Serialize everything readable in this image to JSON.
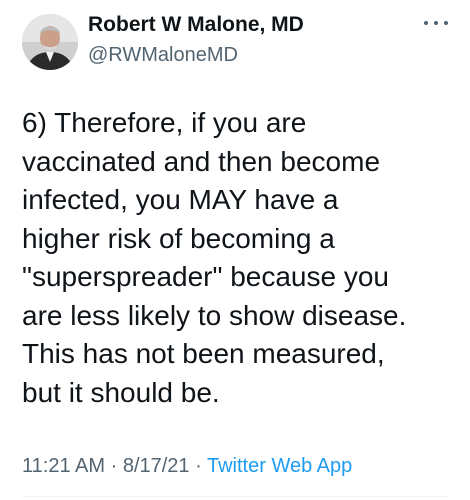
{
  "author": {
    "display_name": "Robert W Malone, MD",
    "handle": "@RWMaloneMD",
    "avatar_icon": "profile-photo"
  },
  "tweet": {
    "text": "6) Therefore, if you are\nvaccinated and then become\ninfected, you MAY have a\nhigher risk of becoming a\n\"superspreader\" because you\nare less likely to show disease.\nThis has not been measured,\nbut it should be.",
    "time": "11:21 AM",
    "date": "8/17/21",
    "separator": "·",
    "source": "Twitter Web App"
  },
  "colors": {
    "text": "#0f1419",
    "secondary": "#536471",
    "link": "#1d9bf0"
  },
  "icons": {
    "more": "more-horizontal-icon"
  }
}
